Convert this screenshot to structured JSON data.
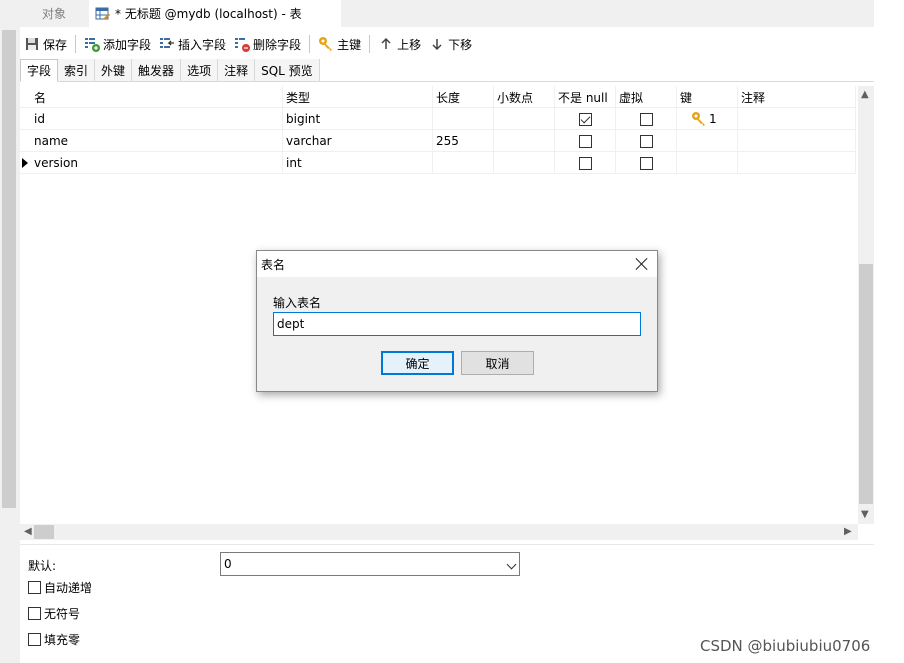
{
  "tabs": {
    "objects": "对象",
    "table_tab": "* 无标题 @mydb (localhost) - 表"
  },
  "toolbar": {
    "save": "保存",
    "add_field": "添加字段",
    "insert_field": "插入字段",
    "delete_field": "删除字段",
    "primary_key": "主键",
    "move_up": "上移",
    "move_down": "下移"
  },
  "subtabs": [
    "字段",
    "索引",
    "外键",
    "触发器",
    "选项",
    "注释",
    "SQL 预览"
  ],
  "grid": {
    "columns": [
      "名",
      "类型",
      "长度",
      "小数点",
      "不是 null",
      "虚拟",
      "键",
      "注释"
    ],
    "rows": [
      {
        "name": "id",
        "type": "bigint",
        "length": "",
        "decimals": "",
        "not_null": true,
        "virtual": false,
        "key": "1",
        "comment": ""
      },
      {
        "name": "name",
        "type": "varchar",
        "length": "255",
        "decimals": "",
        "not_null": false,
        "virtual": false,
        "key": "",
        "comment": ""
      },
      {
        "name": "version",
        "type": "int",
        "length": "",
        "decimals": "",
        "not_null": false,
        "virtual": false,
        "key": "",
        "comment": ""
      }
    ]
  },
  "bottom": {
    "default_label": "默认:",
    "default_value": "0",
    "auto_increment": "自动递增",
    "unsigned": "无符号",
    "zerofill": "填充零"
  },
  "dialog": {
    "title": "表名",
    "prompt": "输入表名",
    "input_value": "dept",
    "ok": "确定",
    "cancel": "取消"
  },
  "watermark": "CSDN @biubiubiu0706",
  "colors": {
    "accent": "#0078d7",
    "key_icon": "#e8a317"
  }
}
